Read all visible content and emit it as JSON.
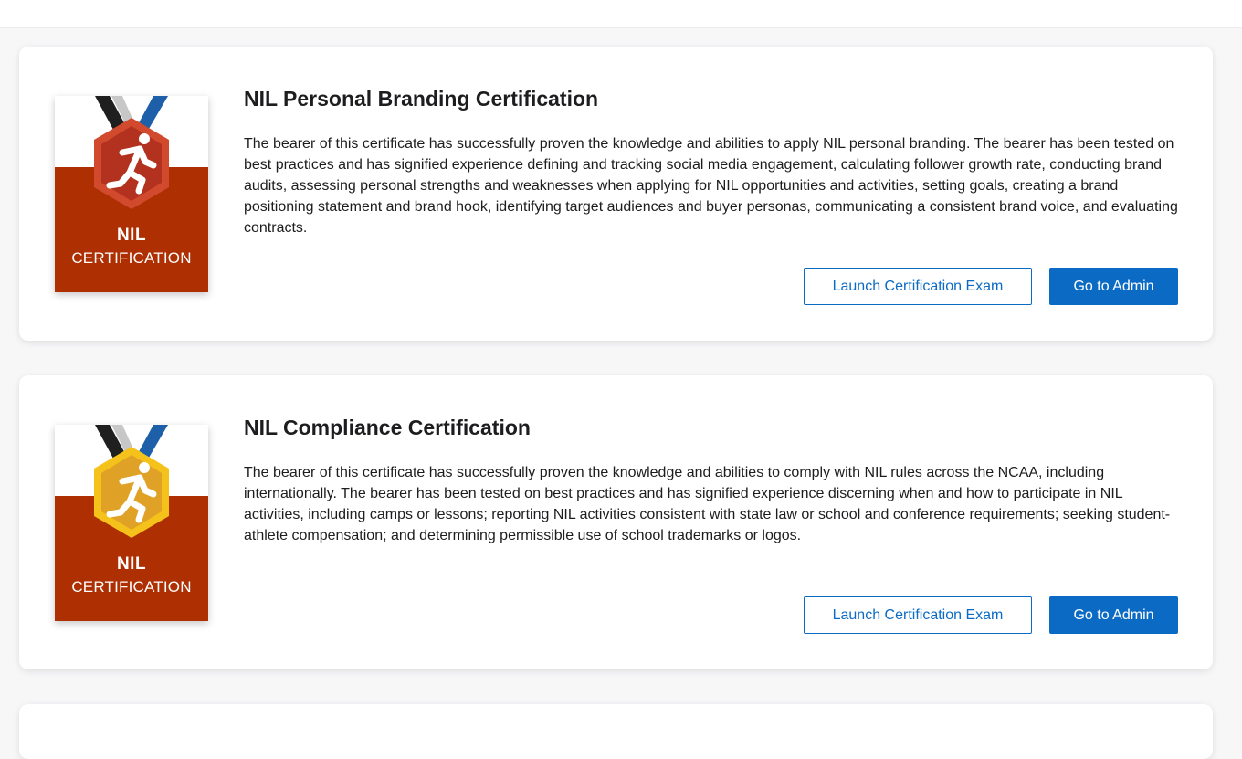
{
  "certifications": [
    {
      "title": "NIL Personal Branding Certification",
      "description": "The bearer of this certificate has successfully proven the knowledge and abilities to apply NIL personal branding. The bearer has been tested on best practices and has signified experience defining and tracking social media engagement, calculating follower growth rate, conducting brand audits, assessing personal strengths and weaknesses when applying for NIL opportunities and activities, setting goals, creating a brand positioning statement and brand hook, identifying target audiences and buyer personas, communicating a consistent brand voice, and evaluating contracts.",
      "badge": {
        "line1": "NIL",
        "line2": "CERTIFICATION",
        "icon": "runner-icon",
        "medal_color": "#b3321f",
        "medal_border": "#d24a2e",
        "background": "#ad2f02"
      },
      "launch_label": "Launch Certification Exam",
      "admin_label": "Go to Admin"
    },
    {
      "title": "NIL Compliance Certification",
      "description": "The bearer of this certificate has successfully proven the knowledge and abilities to comply with NIL rules across the NCAA, including internationally. The bearer has been tested on best practices and has signified experience discerning when and how to participate in NIL activities, including camps or lessons; reporting NIL activities consistent with state law or school and conference requirements; seeking student-athlete compensation; and determining permissible use of school trademarks or logos.",
      "badge": {
        "line1": "NIL",
        "line2": "CERTIFICATION",
        "icon": "runner-icon",
        "medal_color": "#e0a226",
        "medal_border": "#f5c21b",
        "background": "#ad2f02"
      },
      "launch_label": "Launch Certification Exam",
      "admin_label": "Go to Admin"
    }
  ],
  "colors": {
    "primary": "#0b6bc4",
    "text": "#1d1d1f",
    "page_background": "#f7f7f8"
  }
}
